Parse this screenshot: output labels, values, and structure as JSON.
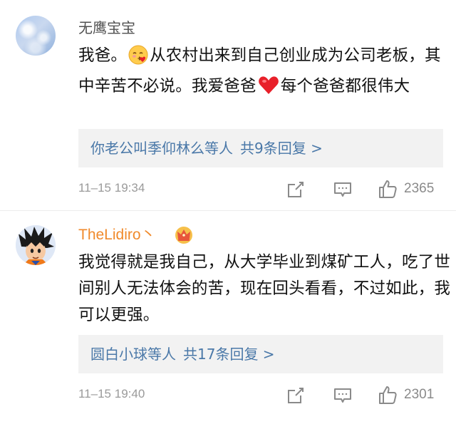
{
  "comments": [
    {
      "username": "无鹰宝宝",
      "text_before_emoji": "我爸。",
      "text_after_emoji": "从农村出来到自己创业成为公司老板，其中辛苦不必说。我爱爸爸",
      "text_after_heart": "每个爸爸都很伟大",
      "reply_names": "你老公叫季仰林么等人",
      "reply_count": "共9条回复 >",
      "time": "11–15 19:34",
      "likes": "2365"
    },
    {
      "username": "TheLidiro丶",
      "text": "我觉得就是我自己，从大学毕业到煤矿工人，吃了世间别人无法体会的苦，现在回头看看，不过如此，我可以更强。",
      "reply_names": "圆白小球等人",
      "reply_count": "共17条回复 >",
      "time": "11–15 19:40",
      "likes": "2301"
    }
  ],
  "icons": {
    "emoji": "kissing-face-emoji",
    "heart": "red-heart-icon",
    "crown": "crown-icon",
    "share": "share-icon",
    "comment": "comment-icon",
    "like": "thumbs-up-icon"
  },
  "colors": {
    "username_normal": "#505050",
    "username_vip": "#f08a2b",
    "reply_link": "#4a78a8",
    "meta": "#9a9a9a",
    "heart": "#e8202a"
  }
}
